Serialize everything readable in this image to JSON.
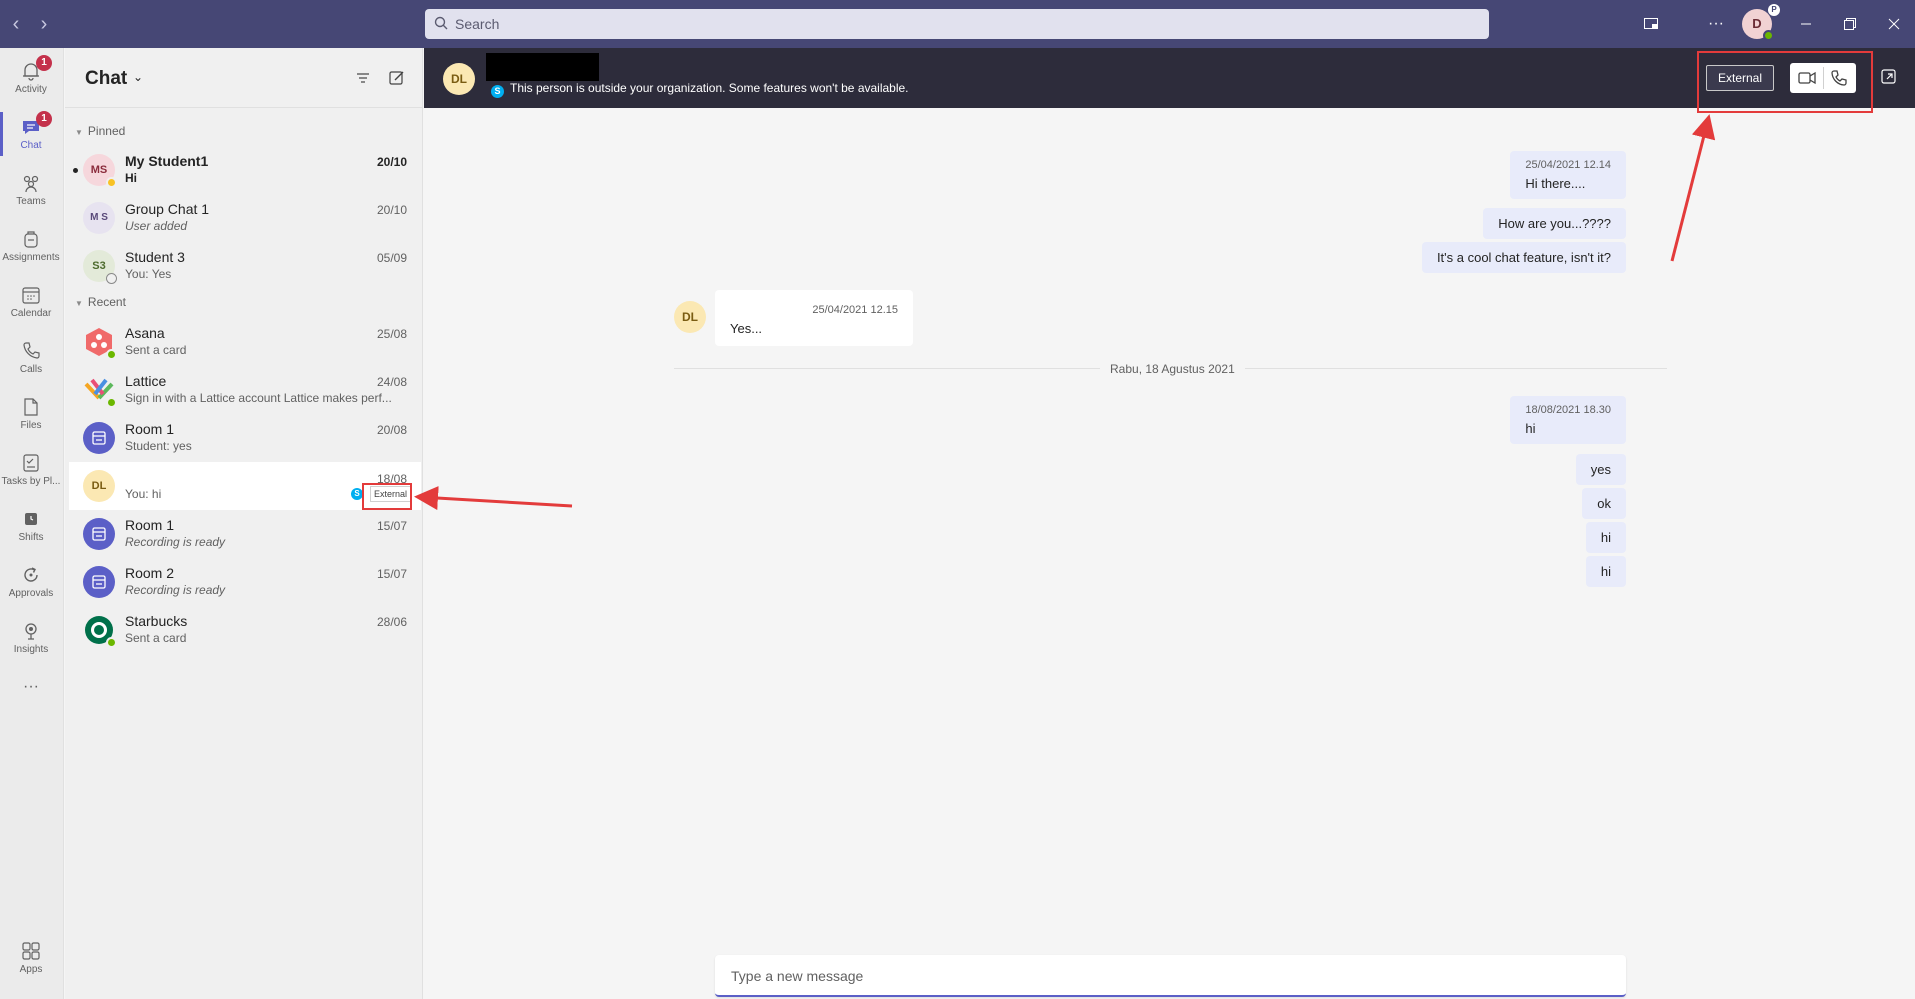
{
  "titlebar": {
    "search_placeholder": "Search",
    "more_label": "···",
    "user_initial": "D",
    "user_badge": "P"
  },
  "rail": {
    "items": [
      {
        "label": "Activity",
        "icon": "bell-icon",
        "badge": "1"
      },
      {
        "label": "Chat",
        "icon": "chat-icon",
        "badge": "1"
      },
      {
        "label": "Teams",
        "icon": "teams-icon"
      },
      {
        "label": "Assignments",
        "icon": "backpack-icon"
      },
      {
        "label": "Calendar",
        "icon": "calendar-icon"
      },
      {
        "label": "Calls",
        "icon": "phone-icon"
      },
      {
        "label": "Files",
        "icon": "file-icon"
      },
      {
        "label": "Tasks by Pl...",
        "icon": "tasks-icon"
      },
      {
        "label": "Shifts",
        "icon": "clock-icon"
      },
      {
        "label": "Approvals",
        "icon": "approvals-icon"
      },
      {
        "label": "Insights",
        "icon": "insights-icon"
      },
      {
        "label": "···",
        "icon": "more-icon"
      },
      {
        "label": "Apps",
        "icon": "apps-icon"
      }
    ]
  },
  "chatlist": {
    "title": "Chat",
    "pinned_label": "Pinned",
    "recent_label": "Recent",
    "pinned": [
      {
        "initials": "MS",
        "name": "My Student1",
        "preview": "Hi",
        "date": "20/10"
      },
      {
        "initials": "M S",
        "name": "Group Chat 1",
        "preview": "User added",
        "date": "20/10"
      },
      {
        "initials": "S3",
        "name": "Student 3",
        "preview": "You: Yes",
        "date": "05/09"
      }
    ],
    "recent": [
      {
        "name": "Asana",
        "preview": "Sent a card",
        "date": "25/08"
      },
      {
        "name": "Lattice",
        "preview": "Sign in with a Lattice account Lattice makes perf...",
        "date": "24/08"
      },
      {
        "name": "Room 1",
        "preview": "Student: yes",
        "date": "20/08"
      },
      {
        "initials": "DL",
        "name": "",
        "preview": "You: hi",
        "date": "18/08",
        "tag": "External",
        "skype": "S"
      },
      {
        "name": "Room 1",
        "preview": "Recording is ready",
        "date": "15/07"
      },
      {
        "name": "Room 2",
        "preview": "Recording is ready",
        "date": "15/07"
      },
      {
        "name": "Starbucks",
        "preview": "Sent a card",
        "date": "28/06"
      }
    ]
  },
  "conversation": {
    "initials": "DL",
    "skype": "S",
    "external_notice": "This person is outside your organization. Some features won't be available.",
    "external_button": "External",
    "date_divider": "Rabu, 18 Agustus 2021",
    "composer_placeholder": "Type a new message",
    "messages": [
      {
        "timestamp": "25/04/2021 12.14",
        "text": "Hi there...."
      },
      {
        "text": "How are you...????"
      },
      {
        "text": "It's a cool chat feature, isn't it?"
      },
      {
        "timestamp": "25/04/2021 12.15",
        "text": "Yes..."
      },
      {
        "timestamp": "18/08/2021 18.30",
        "text": "hi"
      },
      {
        "text": "yes"
      },
      {
        "text": "ok"
      },
      {
        "text": "hi"
      },
      {
        "text": "hi"
      }
    ]
  },
  "colors": {
    "titlebar": "#464775",
    "accent": "#5b5fc7",
    "header": "#2d2c3b",
    "annotation_red": "#e33b3b",
    "badge_red": "#c4314b",
    "online_green": "#6bb700"
  }
}
